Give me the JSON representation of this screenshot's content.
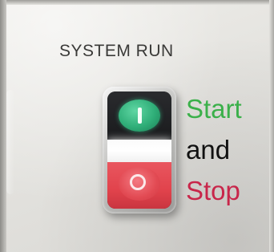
{
  "panel": {
    "label": "SYSTEM RUN"
  },
  "push_button": {
    "start_icon": "start-line-icon",
    "stop_icon": "stop-circle-icon",
    "start_color": "#2faa6f",
    "stop_color": "#e24a53"
  },
  "caption": {
    "start": "Start",
    "and": "and",
    "stop": "Stop",
    "start_color": "#3bb04a",
    "and_color": "#111111",
    "stop_color": "#c8264a"
  }
}
